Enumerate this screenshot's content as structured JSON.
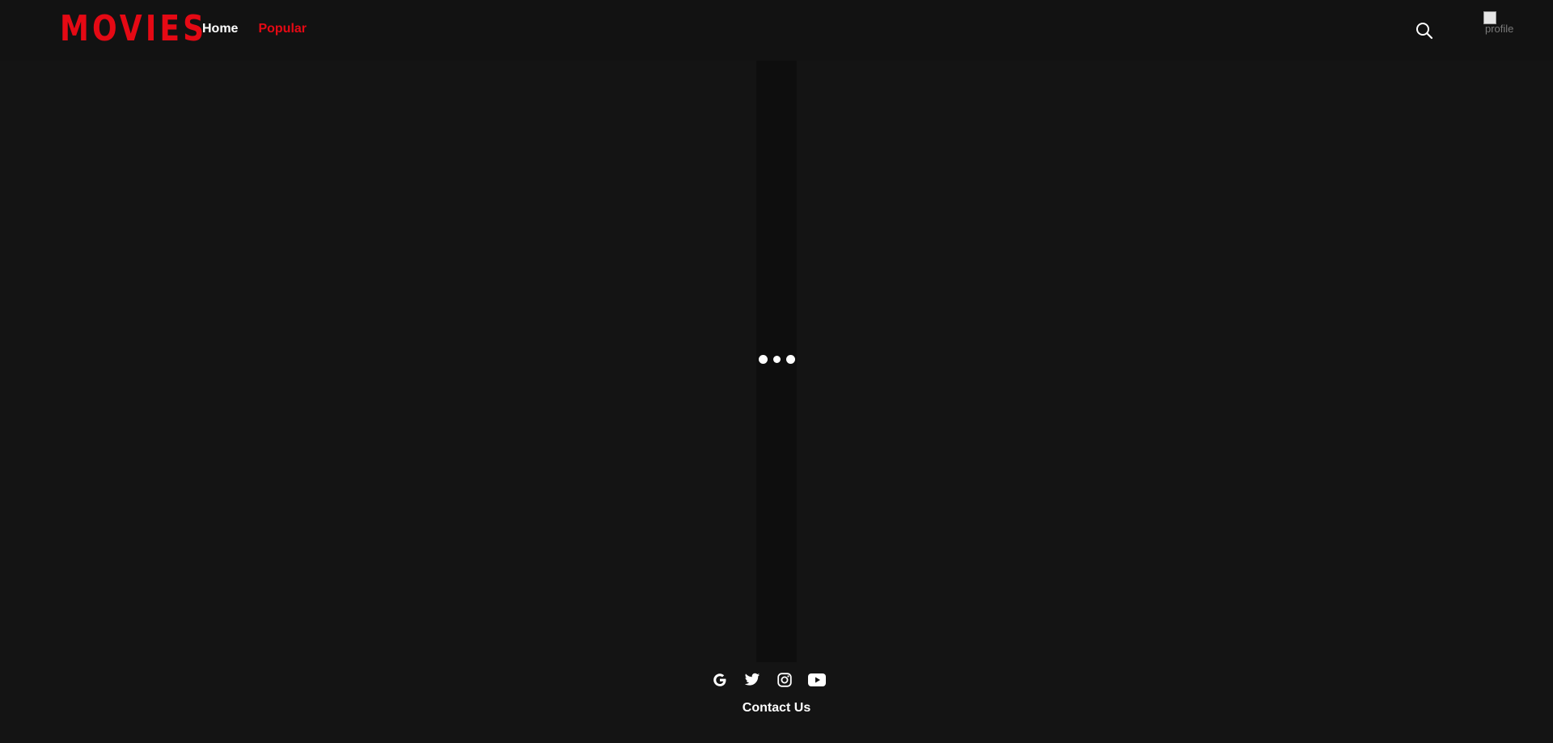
{
  "brand": {
    "logo_text": "MOVIES",
    "accent_color": "#e50914"
  },
  "nav": {
    "items": [
      {
        "label": "Home",
        "active": false
      },
      {
        "label": "Popular",
        "active": true
      }
    ]
  },
  "header": {
    "search_icon": "search-icon",
    "profile_alt": "profile"
  },
  "main": {
    "loading_indicator": "three-dots-loader"
  },
  "footer": {
    "social_icons": [
      "google-icon",
      "twitter-icon",
      "instagram-icon",
      "youtube-icon"
    ],
    "contact_label": "Contact Us"
  }
}
